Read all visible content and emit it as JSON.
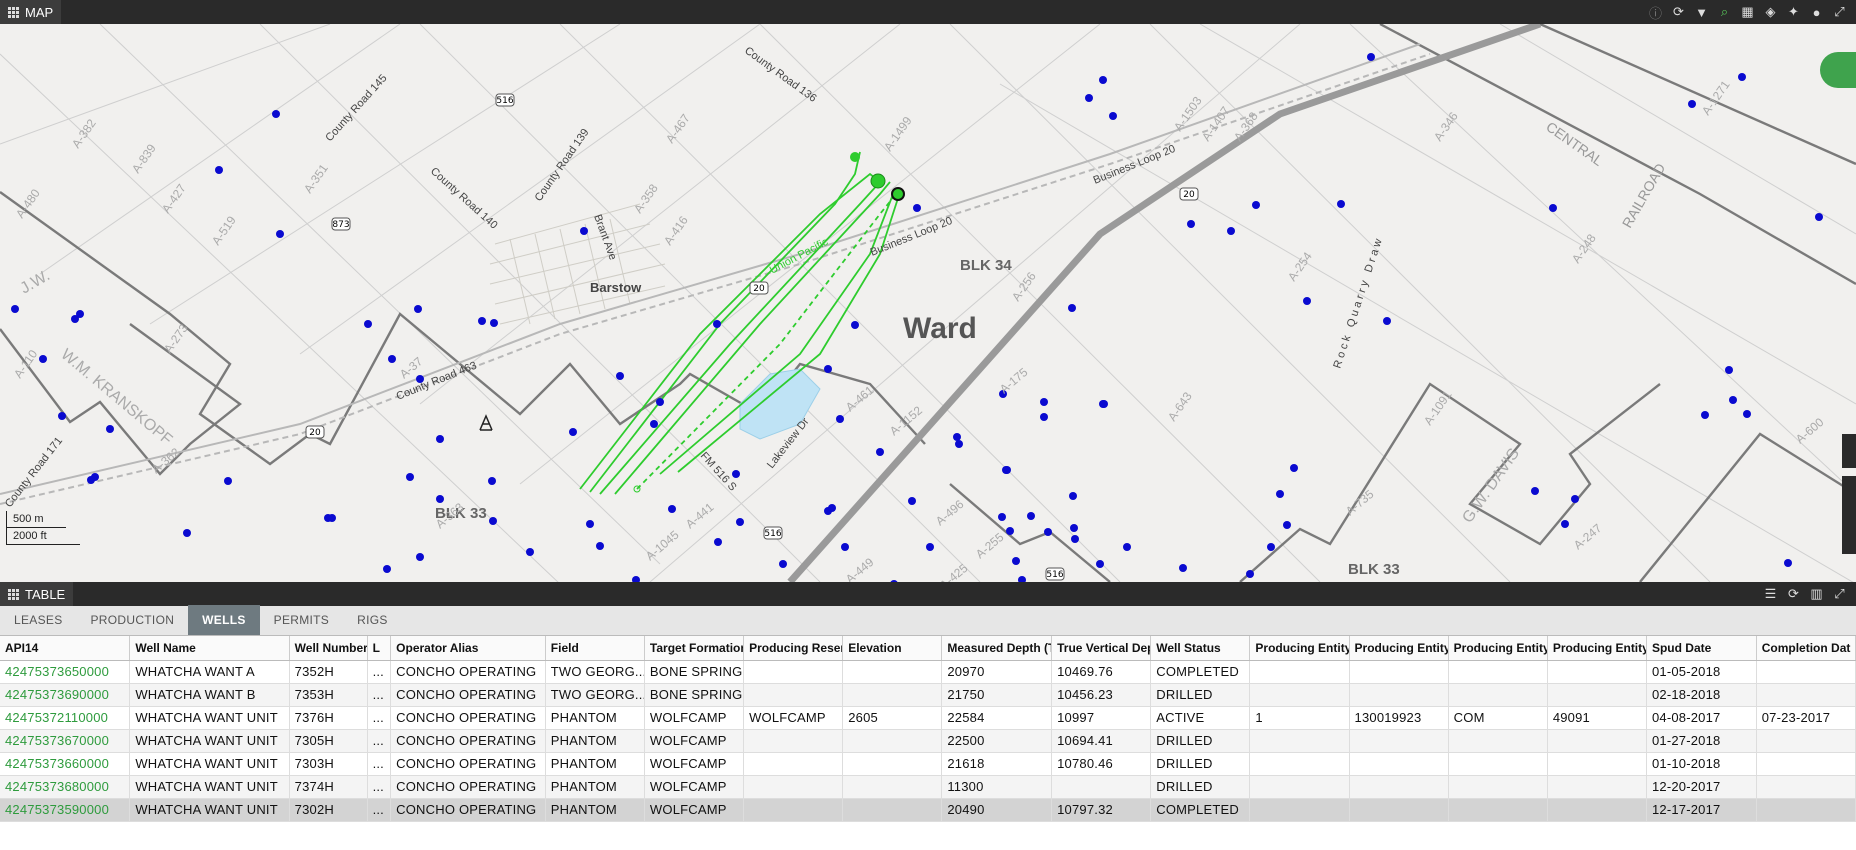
{
  "map_panel": {
    "title": "MAP"
  },
  "map": {
    "county_label": "Ward",
    "town_label": "Barstow",
    "blocks": [
      "BLK 34",
      "BLK 33",
      "BLK 33"
    ],
    "roads": [
      "County Road 145",
      "County Road 140",
      "County Road 139",
      "County Road 136",
      "County Road 463",
      "County Road 171",
      "Business Loop 20",
      "Business Loop 20",
      "Union Pacific",
      "Lakeview Dr",
      "FM 516 S",
      "Brant Ave",
      "Rock Quarry Draw",
      "RAILROAD",
      "CENTRAL"
    ],
    "highway_shields": [
      "516",
      "873",
      "20",
      "20",
      "20",
      "516",
      "516",
      "20"
    ],
    "abstract_labels": [
      "A-382",
      "A-839",
      "A-427",
      "A-519",
      "A-351",
      "A-480",
      "A-273",
      "A-110",
      "A-368",
      "A-467",
      "A-358",
      "A-416",
      "A-256",
      "A-1499",
      "A-1503",
      "A-1407",
      "A-346",
      "A-1271",
      "A-248",
      "A-254",
      "A-1091",
      "A-643",
      "A-1152",
      "A-461",
      "A-441",
      "A-1045",
      "A-449",
      "A-425",
      "A-496",
      "A-255",
      "A-735",
      "A-247",
      "A-600",
      "A-362",
      "A-363",
      "A-175",
      "A-37"
    ],
    "survey_names": [
      "J.W.",
      "W.M. KRANSKOPF",
      "G.W. DAVIS"
    ],
    "scale_metric": "500 m",
    "scale_imperial": "2000 ft",
    "colors": {
      "well_dot": "#0a0ad0",
      "lateral": "#2ecc2e",
      "road": "#9a9a9a",
      "survey_line": "#777777",
      "water": "#bfe3f5"
    }
  },
  "table_panel": {
    "title": "TABLE"
  },
  "tabs": [
    {
      "label": "LEASES",
      "active": false
    },
    {
      "label": "PRODUCTION",
      "active": false
    },
    {
      "label": "WELLS",
      "active": true
    },
    {
      "label": "PERMITS",
      "active": false
    },
    {
      "label": "RIGS",
      "active": false
    }
  ],
  "table": {
    "columns": [
      "API14",
      "Well Name",
      "Well Number",
      "L",
      "Operator Alias",
      "Field",
      "Target Formation",
      "Producing Reserv",
      "Elevation",
      "Measured Depth (TD",
      "True Vertical Depth",
      "Well Status",
      "Producing Entity C",
      "Producing Entity I",
      "Producing Entity T",
      "Producing Entity L",
      "Spud Date",
      "Completion Dat"
    ],
    "rows": [
      [
        "42475373650000",
        "WHATCHA WANT A",
        "7352H",
        "...",
        "CONCHO OPERATING",
        "TWO GEORG...",
        "BONE SPRING",
        "",
        "",
        "20970",
        "10469.76",
        "COMPLETED",
        "",
        "",
        "",
        "",
        "01-05-2018",
        ""
      ],
      [
        "42475373690000",
        "WHATCHA WANT B",
        "7353H",
        "...",
        "CONCHO OPERATING",
        "TWO GEORG...",
        "BONE SPRING",
        "",
        "",
        "21750",
        "10456.23",
        "DRILLED",
        "",
        "",
        "",
        "",
        "02-18-2018",
        ""
      ],
      [
        "42475372110000",
        "WHATCHA WANT UNIT",
        "7376H",
        "...",
        "CONCHO OPERATING",
        "PHANTOM",
        "WOLFCAMP",
        "WOLFCAMP",
        "2605",
        "22584",
        "10997",
        "ACTIVE",
        "1",
        "130019923",
        "COM",
        "49091",
        "04-08-2017",
        "07-23-2017"
      ],
      [
        "42475373670000",
        "WHATCHA WANT UNIT",
        "7305H",
        "...",
        "CONCHO OPERATING",
        "PHANTOM",
        "WOLFCAMP",
        "",
        "",
        "22500",
        "10694.41",
        "DRILLED",
        "",
        "",
        "",
        "",
        "01-27-2018",
        ""
      ],
      [
        "42475373660000",
        "WHATCHA WANT UNIT",
        "7303H",
        "...",
        "CONCHO OPERATING",
        "PHANTOM",
        "WOLFCAMP",
        "",
        "",
        "21618",
        "10780.46",
        "DRILLED",
        "",
        "",
        "",
        "",
        "01-10-2018",
        ""
      ],
      [
        "42475373680000",
        "WHATCHA WANT UNIT",
        "7374H",
        "...",
        "CONCHO OPERATING",
        "PHANTOM",
        "WOLFCAMP",
        "",
        "",
        "11300",
        "",
        "DRILLED",
        "",
        "",
        "",
        "",
        "12-20-2017",
        ""
      ],
      [
        "42475373590000",
        "WHATCHA WANT UNIT",
        "7302H",
        "...",
        "CONCHO OPERATING",
        "PHANTOM",
        "WOLFCAMP",
        "",
        "",
        "20490",
        "10797.32",
        "COMPLETED",
        "",
        "",
        "",
        "",
        "12-17-2017",
        ""
      ]
    ],
    "selected_row": 6
  }
}
